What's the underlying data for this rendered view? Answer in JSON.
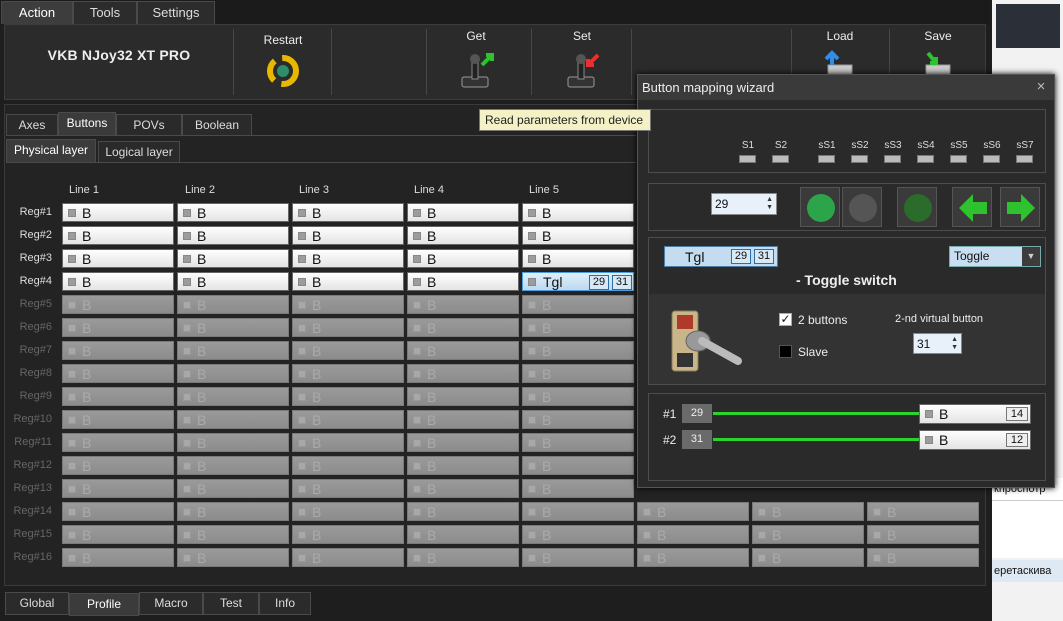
{
  "menu": {
    "tabs": [
      {
        "label": "Action"
      },
      {
        "label": "Tools"
      },
      {
        "label": "Settings"
      }
    ]
  },
  "ribbon": {
    "device_name": "VKB NJoy32 XT PRO",
    "restart_label": "Restart",
    "get_label": "Get",
    "set_label": "Set",
    "load_label": "Load",
    "save_label": "Save"
  },
  "tooltip": "Read parameters from device",
  "subtabs": [
    {
      "label": "Axes"
    },
    {
      "label": "Buttons"
    },
    {
      "label": "POVs"
    },
    {
      "label": "Boolean"
    }
  ],
  "layertabs": [
    {
      "label": "Physical layer"
    },
    {
      "label": "Logical layer"
    }
  ],
  "grid": {
    "columns": [
      "Line 1",
      "Line 2",
      "Line 3",
      "Line 4",
      "Line 5"
    ],
    "rows": [
      "Reg#1",
      "Reg#2",
      "Reg#3",
      "Reg#4",
      "Reg#5",
      "Reg#6",
      "Reg#7",
      "Reg#8",
      "Reg#9",
      "Reg#10",
      "Reg#11",
      "Reg#12",
      "Reg#13",
      "Reg#14",
      "Reg#15",
      "Reg#16"
    ],
    "cell_value": "B",
    "selected_value": "Tgl",
    "selected_badges": [
      "29",
      "31"
    ]
  },
  "bottom_tabs": [
    {
      "label": "Global"
    },
    {
      "label": "Profile"
    },
    {
      "label": "Macro"
    },
    {
      "label": "Test"
    },
    {
      "label": "Info"
    }
  ],
  "wizard": {
    "title": "Button mapping wizard",
    "close": "×",
    "shift_labels": [
      "S1",
      "S2",
      "sS1",
      "sS2",
      "sS3",
      "sS4",
      "sS5",
      "sS6",
      "sS7"
    ],
    "button_number": "29",
    "chip_label": "Tgl",
    "chip_badges": [
      "29",
      "31"
    ],
    "mode_value": "Toggle",
    "mode_desc": "- Toggle switch",
    "two_buttons_label": "2 buttons",
    "two_buttons_checked": "✓",
    "slave_label": "Slave",
    "second_vb_label": "2-nd virtual button",
    "second_vb_value": "31",
    "mappings": [
      {
        "index": "#1",
        "physical": "29",
        "value": "B",
        "target": "14"
      },
      {
        "index": "#2",
        "physical": "31",
        "value": "B",
        "target": "12"
      }
    ]
  },
  "bg_window": {
    "text1": "кпроспотр",
    "text2": "еретаскива"
  }
}
